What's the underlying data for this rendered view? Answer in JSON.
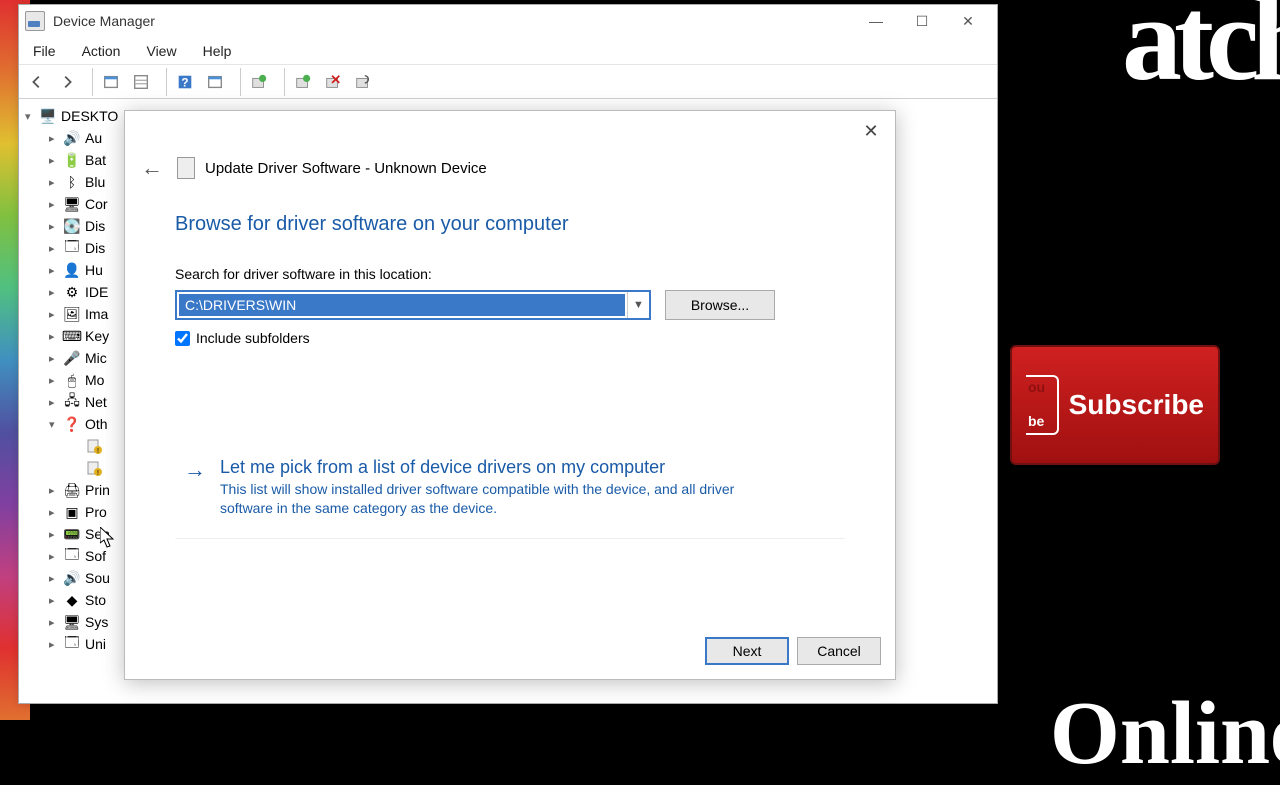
{
  "bg": {
    "textTop": "atch",
    "textBottom": "Online",
    "subscribe": "Subscribe"
  },
  "window": {
    "title": "Device Manager"
  },
  "menu": {
    "file": "File",
    "action": "Action",
    "view": "View",
    "help": "Help"
  },
  "tree": {
    "root": "DESKTO",
    "items": [
      "Au",
      "Bat",
      "Blu",
      "Cor",
      "Dis",
      "Dis",
      "Hu",
      "IDE",
      "Ima",
      "Key",
      "Mic",
      "Mo",
      "Net",
      "Oth",
      "Prin",
      "Pro",
      "Sen",
      "Sof",
      "Sou",
      "Sto",
      "Sys",
      "Uni"
    ]
  },
  "wizard": {
    "title": "Update Driver Software - Unknown Device",
    "heading": "Browse for driver software on your computer",
    "searchLabel": "Search for driver software in this location:",
    "path": "C:\\DRIVERS\\WIN",
    "browse": "Browse...",
    "includeSubfolders": "Include subfolders",
    "pickTitle": "Let me pick from a list of device drivers on my computer",
    "pickDesc": "This list will show installed driver software compatible with the device, and all driver software in the same category as the device.",
    "next": "Next",
    "cancel": "Cancel"
  }
}
